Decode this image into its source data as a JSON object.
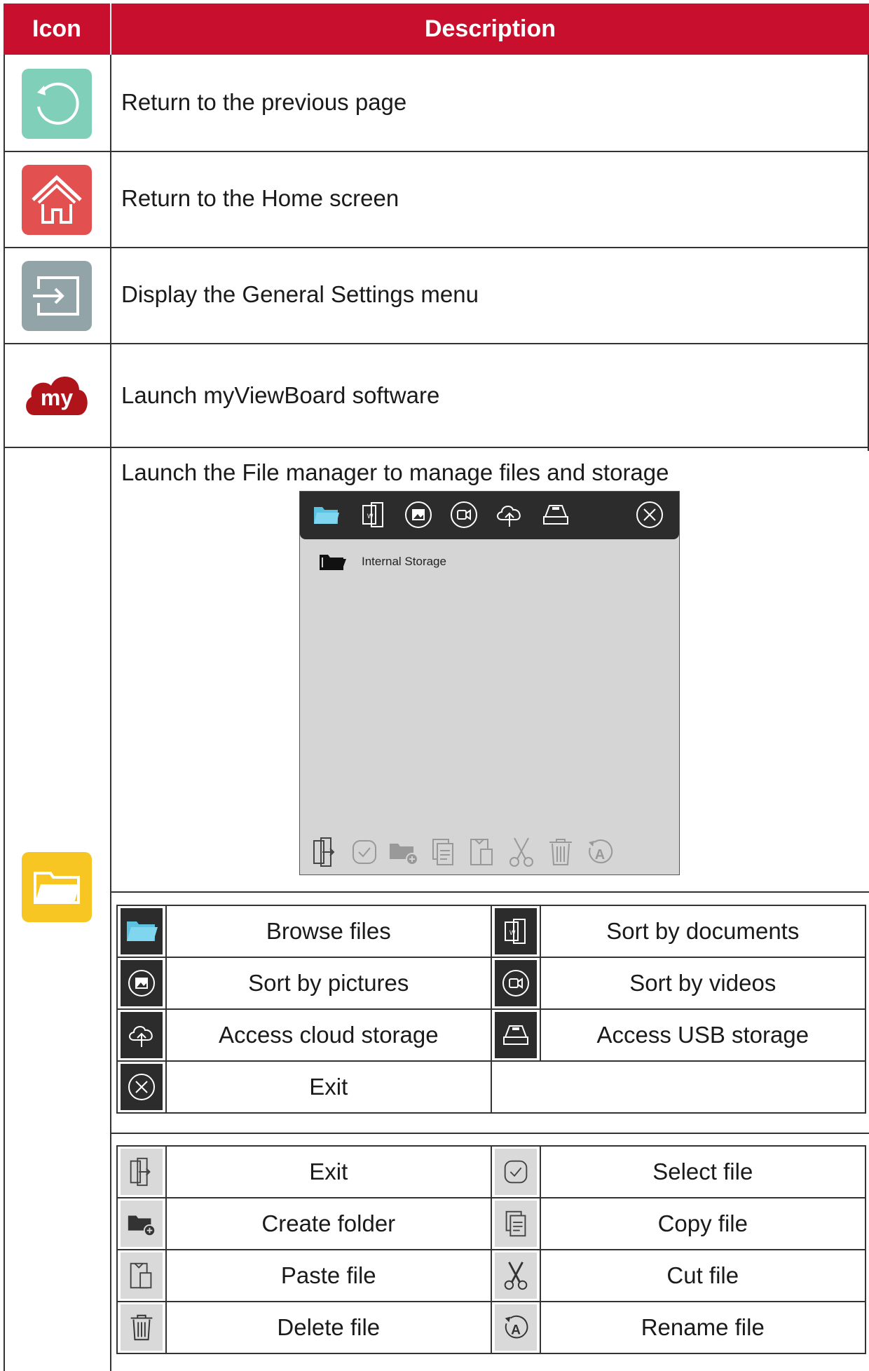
{
  "header": {
    "icon_col": "Icon",
    "desc_col": "Description"
  },
  "rows": [
    {
      "icon": "back-icon",
      "desc": "Return to the previous page",
      "color": "#7fcfb9"
    },
    {
      "icon": "home-icon",
      "desc": "Return to the Home screen",
      "color": "#e25050"
    },
    {
      "icon": "input-icon",
      "desc": "Display the General Settings menu",
      "color": "#93a4a8"
    },
    {
      "icon": "myviewboard-icon",
      "desc": "Launch myViewBoard software",
      "color": "#b0141b"
    },
    {
      "icon": "folder-icon",
      "desc": "Launch the File manager to manage files and storage",
      "color": "#f7c623"
    }
  ],
  "file_manager": {
    "storage_label": "Internal Storage",
    "top_icons": [
      "folder-icon",
      "document-icon",
      "picture-icon",
      "video-icon",
      "cloud-icon",
      "usb-icon",
      "close-icon"
    ],
    "bottom_icons": [
      "exit-icon",
      "select-icon",
      "create-folder-icon",
      "copy-icon",
      "paste-icon",
      "cut-icon",
      "delete-icon",
      "rename-icon"
    ]
  },
  "legend_top": [
    {
      "left_icon": "folder-icon",
      "left": "Browse files",
      "right_icon": "document-icon",
      "right": "Sort by documents"
    },
    {
      "left_icon": "picture-icon",
      "left": "Sort by pictures",
      "right_icon": "video-icon",
      "right": "Sort by videos"
    },
    {
      "left_icon": "cloud-icon",
      "left": "Access cloud storage",
      "right_icon": "usb-icon",
      "right": "Access USB storage"
    },
    {
      "left_icon": "close-icon",
      "left": "Exit",
      "right_icon": "",
      "right": ""
    }
  ],
  "legend_bottom": [
    {
      "left_icon": "exit-icon",
      "left": "Exit",
      "right_icon": "select-icon",
      "right": "Select file"
    },
    {
      "left_icon": "create-folder-icon",
      "left": "Create folder",
      "right_icon": "copy-icon",
      "right": "Copy file"
    },
    {
      "left_icon": "paste-icon",
      "left": "Paste file",
      "right_icon": "cut-icon",
      "right": "Cut file"
    },
    {
      "left_icon": "delete-icon",
      "left": "Delete file",
      "right_icon": "rename-icon",
      "right": "Rename file"
    }
  ],
  "colors": {
    "header": "#c8102e",
    "accent_blue": "#5bc3df",
    "toolbar": "#2c2c2c"
  }
}
